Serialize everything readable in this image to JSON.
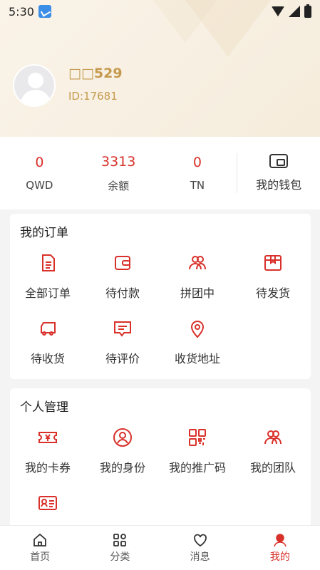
{
  "status_bar": {
    "time": "5:30"
  },
  "profile": {
    "name": "□□529",
    "id_text": "ID:17681"
  },
  "stats": [
    {
      "value": "0",
      "label": "QWD"
    },
    {
      "value": "3313",
      "label": "余额"
    },
    {
      "value": "0",
      "label": "TN"
    }
  ],
  "wallet": {
    "label": "我的钱包",
    "icon": "wallet-icon"
  },
  "orders": {
    "title": "我的订单",
    "items": [
      {
        "label": "全部订单",
        "icon": "document-icon"
      },
      {
        "label": "待付款",
        "icon": "wallet-icon"
      },
      {
        "label": "拼团中",
        "icon": "group-icon"
      },
      {
        "label": "待发货",
        "icon": "box-icon"
      },
      {
        "label": "待收货",
        "icon": "truck-icon"
      },
      {
        "label": "待评价",
        "icon": "comment-icon"
      },
      {
        "label": "收货地址",
        "icon": "location-pin-icon"
      }
    ]
  },
  "personal": {
    "title": "个人管理",
    "items": [
      {
        "label": "我的卡券",
        "icon": "coupon-icon"
      },
      {
        "label": "我的身份",
        "icon": "user-circle-icon"
      },
      {
        "label": "我的推广码",
        "icon": "qr-code-icon"
      },
      {
        "label": "我的团队",
        "icon": "team-icon"
      },
      {
        "label": "",
        "icon": "id-card-icon"
      }
    ]
  },
  "bottom_nav": [
    {
      "label": "首页",
      "icon": "home-icon"
    },
    {
      "label": "分类",
      "icon": "category-icon"
    },
    {
      "label": "消息",
      "icon": "heart-icon"
    },
    {
      "label": "我的",
      "icon": "profile-icon",
      "active": true
    }
  ],
  "colors": {
    "accent": "#d9302a",
    "gold": "#c59a4e",
    "header_bg": "#f7efe1"
  }
}
